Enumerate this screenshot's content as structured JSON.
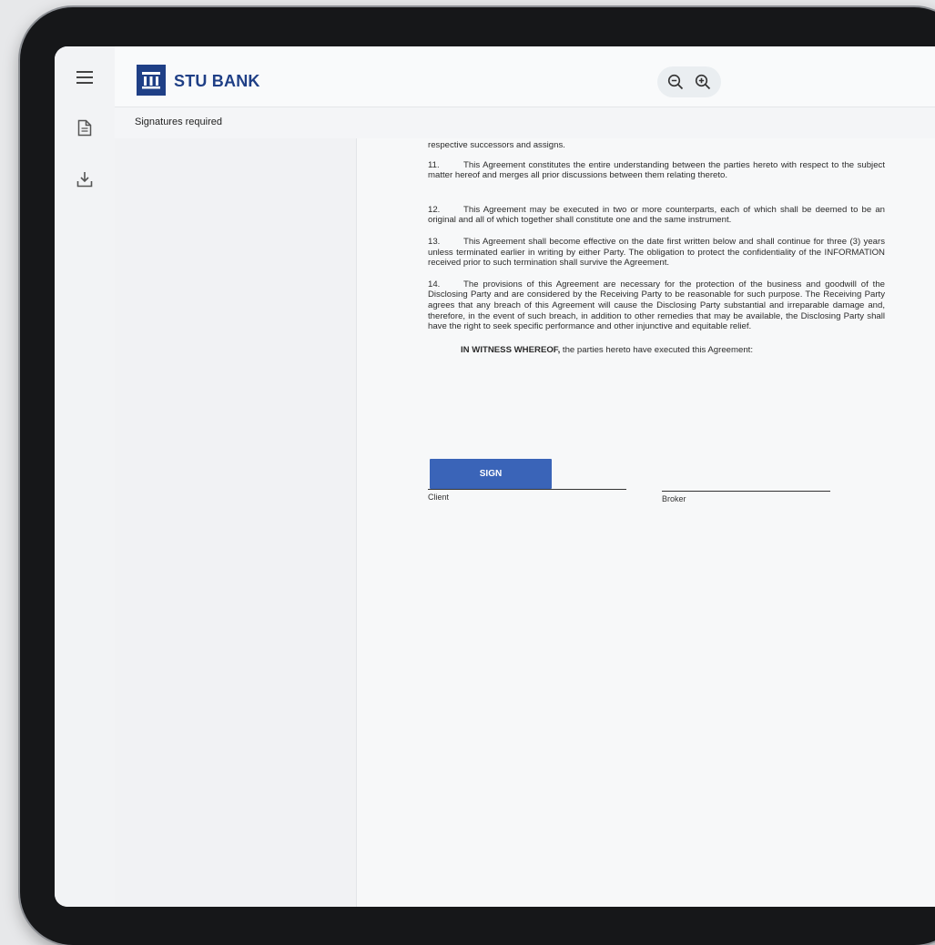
{
  "app": {
    "brand": "STU BANK"
  },
  "toolbar": {
    "zoom_out_icon": "zoom-out-icon",
    "zoom_in_icon": "zoom-in-icon"
  },
  "rail": {
    "menu_icon": "hamburger-menu-icon",
    "document_icon": "document-icon",
    "download_icon": "download-icon"
  },
  "subheader": {
    "title": "Signatures required"
  },
  "document": {
    "top_fragment": "respective successors and assigns.",
    "paragraphs": [
      {
        "num": "11.",
        "text": "This Agreement constitutes the entire understanding between the parties hereto with respect to the subject matter hereof and merges all prior discussions between them relating thereto."
      },
      {
        "num": "12.",
        "text": "This Agreement may be executed in two or more counterparts, each of which shall be deemed to be an original and all of which together shall constitute one and the same instrument."
      },
      {
        "num": "13.",
        "text": "This Agreement shall become effective on the date first written below and shall continue for three (3) years unless terminated earlier in writing by either Party. The obligation to protect the confidentiality of the INFORMATION received prior to such termination shall survive the Agreement."
      },
      {
        "num": "14.",
        "text": "The provisions of this Agreement are necessary for the protection of the business and goodwill of the Disclosing Party and are considered by the Receiving Party to be reasonable for such purpose. The Receiving Party agrees that any breach of this Agreement will cause the Disclosing Party substantial and irreparable damage and, therefore, in the event of such breach, in addition to other remedies that may be available, the Disclosing Party shall have the right to seek specific performance and other injunctive and equitable relief."
      }
    ],
    "witness_bold": "IN WITNESS WHEREOF,",
    "witness_rest": " the parties hereto have executed this Agreement:",
    "sign_button": "SIGN",
    "client_label": "Client",
    "broker_label": "Broker"
  },
  "colors": {
    "brand": "#1f3f86",
    "sign_button": "#3a64b8"
  }
}
